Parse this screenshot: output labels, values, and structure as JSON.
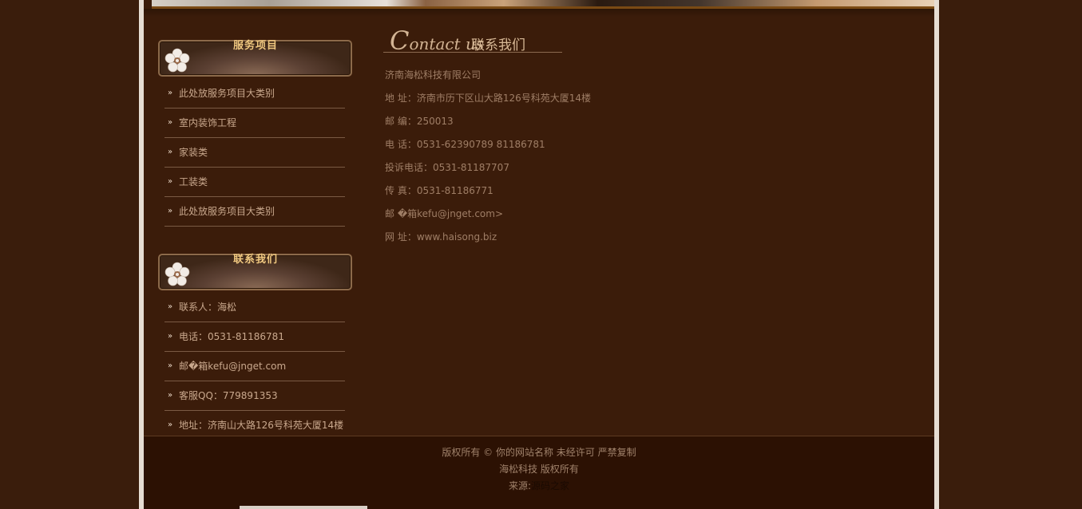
{
  "sidebar": {
    "services": {
      "title": "服务项目",
      "items": [
        {
          "label": "此处放服务项目大类别"
        },
        {
          "label": "室内装饰工程"
        },
        {
          "label": "家装类"
        },
        {
          "label": "工装类"
        },
        {
          "label": "此处放服务项目大类别"
        }
      ]
    },
    "contact": {
      "title": "联系我们",
      "items": [
        {
          "label": "联系人：海松"
        },
        {
          "label": "电话：0531-81186781"
        },
        {
          "label": "邮�箱kefu@jnget.com"
        },
        {
          "label": "客服QQ：779891353"
        },
        {
          "label": "地址：济南山大路126号科苑大厦14楼"
        }
      ]
    }
  },
  "contact_section": {
    "title_en_initial": "C",
    "title_en_rest": "ontact us",
    "title_cn": "联系我们",
    "lines": [
      "济南海松科技有限公司",
      "地 址：济南市历下区山大路126号科苑大厦14楼",
      "邮 编：250013",
      "电 话：0531-62390789 81186781",
      "投诉电话：0531-81187707",
      "传 真：0531-81186771",
      "邮 �箱kefu@jnget.com>",
      "网 址：www.haisong.biz"
    ]
  },
  "footer": {
    "copyright": "版权所有 © 你的网站名称 未经许可 严禁复制",
    "company": "海松科技 版权所有",
    "source_label": "来源:",
    "source_link": "源码之家"
  },
  "colors": {
    "background": "#3a1d0c",
    "accent_gold": "#f0c880",
    "text": "#b69378"
  }
}
